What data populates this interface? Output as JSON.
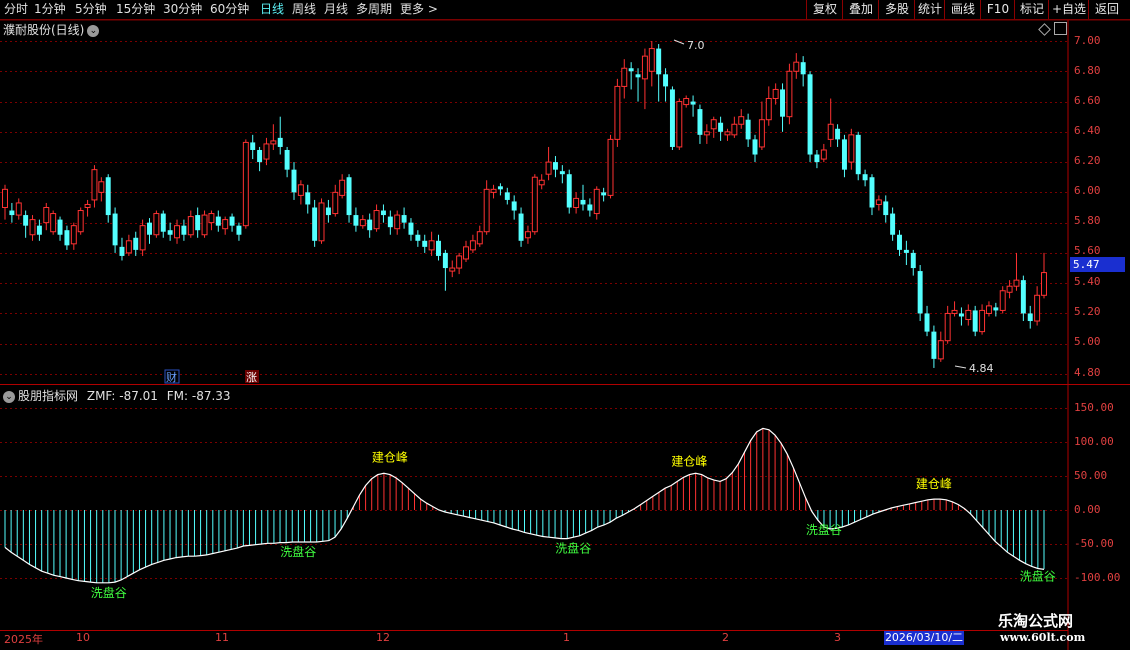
{
  "toolbar": {
    "timeframes": [
      "分时",
      "1分钟",
      "5分钟",
      "15分钟",
      "30分钟",
      "60分钟",
      "日线",
      "周线",
      "月线",
      "多周期",
      "更多 >"
    ],
    "active": "日线",
    "right_buttons": [
      "复权",
      "叠加",
      "多股",
      "统计",
      "画线",
      "F10",
      "标记",
      "+自选",
      "返回"
    ]
  },
  "stock": {
    "title": "濮耐股份(日线)"
  },
  "price_axis": {
    "labels": [
      "7.00",
      "6.80",
      "6.60",
      "6.40",
      "6.20",
      "6.00",
      "5.80",
      "5.60",
      "5.40",
      "5.20",
      "5.00",
      "4.80"
    ],
    "current": "5.47"
  },
  "markers": {
    "high": "7.0",
    "low": "4.84",
    "cai": "财",
    "zhang": "涨"
  },
  "indicator": {
    "name": "股朋指标网",
    "zmf_label": "ZMF: -87.01",
    "fm_label": "FM: -87.33",
    "axis_labels": [
      "150.00",
      "100.00",
      "50.00",
      "0.00",
      "-50.00",
      "-100.00"
    ],
    "peak_label": "建仓峰",
    "valley_label": "洗盘谷"
  },
  "date_axis": {
    "labels": [
      "2025年",
      "10",
      "11",
      "12",
      "1",
      "2",
      "3"
    ],
    "cursor_date": "2026/03/10/二"
  },
  "brand": {
    "name": "乐淘公式网",
    "url": "www.60lt.com"
  },
  "colors": {
    "up": "#ff3232",
    "down": "#54ffff",
    "grid": "#7a0000",
    "axis": "#e04040",
    "peak_text": "#ffff00",
    "valley_text": "#40ff40"
  },
  "chart_data": {
    "type": "candlestick",
    "price_ylim": [
      4.8,
      7.0
    ],
    "candles": [
      [
        5.9,
        6.02,
        5.82,
        6.05
      ],
      [
        5.88,
        5.85,
        5.8,
        5.93
      ],
      [
        5.85,
        5.93,
        5.82,
        5.96
      ],
      [
        5.85,
        5.78,
        5.7,
        5.88
      ],
      [
        5.72,
        5.82,
        5.68,
        5.85
      ],
      [
        5.78,
        5.72,
        5.68,
        5.82
      ],
      [
        5.8,
        5.9,
        5.75,
        5.93
      ],
      [
        5.74,
        5.86,
        5.72,
        5.88
      ],
      [
        5.82,
        5.72,
        5.68,
        5.84
      ],
      [
        5.75,
        5.65,
        5.62,
        5.78
      ],
      [
        5.66,
        5.78,
        5.62,
        5.8
      ],
      [
        5.74,
        5.88,
        5.72,
        5.9
      ],
      [
        5.9,
        5.92,
        5.84,
        5.95
      ],
      [
        5.95,
        6.15,
        5.9,
        6.18
      ],
      [
        6.0,
        6.07,
        5.94,
        6.1
      ],
      [
        6.1,
        5.85,
        5.8,
        6.12
      ],
      [
        5.86,
        5.65,
        5.6,
        5.9
      ],
      [
        5.64,
        5.58,
        5.55,
        5.7
      ],
      [
        5.6,
        5.68,
        5.58,
        5.72
      ],
      [
        5.7,
        5.62,
        5.58,
        5.74
      ],
      [
        5.62,
        5.78,
        5.58,
        5.82
      ],
      [
        5.8,
        5.72,
        5.66,
        5.83
      ],
      [
        5.72,
        5.86,
        5.7,
        5.88
      ],
      [
        5.86,
        5.74,
        5.7,
        5.88
      ],
      [
        5.75,
        5.72,
        5.68,
        5.8
      ],
      [
        5.7,
        5.78,
        5.66,
        5.82
      ],
      [
        5.78,
        5.72,
        5.68,
        5.82
      ],
      [
        5.72,
        5.84,
        5.7,
        5.88
      ],
      [
        5.85,
        5.75,
        5.7,
        5.9
      ],
      [
        5.72,
        5.85,
        5.7,
        5.88
      ],
      [
        5.8,
        5.86,
        5.75,
        5.88
      ],
      [
        5.84,
        5.78,
        5.74,
        5.88
      ],
      [
        5.76,
        5.82,
        5.72,
        5.84
      ],
      [
        5.84,
        5.78,
        5.74,
        5.86
      ],
      [
        5.78,
        5.72,
        5.68,
        5.8
      ],
      [
        5.78,
        6.33,
        5.76,
        6.35
      ],
      [
        6.33,
        6.28,
        6.22,
        6.38
      ],
      [
        6.28,
        6.2,
        6.14,
        6.3
      ],
      [
        6.22,
        6.32,
        6.18,
        6.36
      ],
      [
        6.32,
        6.34,
        6.28,
        6.45
      ],
      [
        6.36,
        6.3,
        6.25,
        6.5
      ],
      [
        6.28,
        6.15,
        6.1,
        6.3
      ],
      [
        6.15,
        6.0,
        5.95,
        6.2
      ],
      [
        5.98,
        6.05,
        5.92,
        6.08
      ],
      [
        6.0,
        5.92,
        5.86,
        6.05
      ],
      [
        5.9,
        5.68,
        5.64,
        5.95
      ],
      [
        5.68,
        5.93,
        5.66,
        5.96
      ],
      [
        5.9,
        5.85,
        5.8,
        5.95
      ],
      [
        5.86,
        6.0,
        5.84,
        6.05
      ],
      [
        5.98,
        6.08,
        5.96,
        6.12
      ],
      [
        6.1,
        5.85,
        5.8,
        6.12
      ],
      [
        5.85,
        5.78,
        5.74,
        5.9
      ],
      [
        5.78,
        5.82,
        5.76,
        5.85
      ],
      [
        5.82,
        5.75,
        5.7,
        5.86
      ],
      [
        5.76,
        5.88,
        5.74,
        5.92
      ],
      [
        5.88,
        5.85,
        5.8,
        5.92
      ],
      [
        5.84,
        5.77,
        5.72,
        5.88
      ],
      [
        5.76,
        5.85,
        5.72,
        5.88
      ],
      [
        5.85,
        5.8,
        5.76,
        5.9
      ],
      [
        5.8,
        5.72,
        5.68,
        5.83
      ],
      [
        5.72,
        5.68,
        5.64,
        5.75
      ],
      [
        5.68,
        5.64,
        5.6,
        5.72
      ],
      [
        5.62,
        5.68,
        5.58,
        5.74
      ],
      [
        5.68,
        5.58,
        5.55,
        5.72
      ],
      [
        5.6,
        5.5,
        5.35,
        5.62
      ],
      [
        5.48,
        5.5,
        5.44,
        5.55
      ],
      [
        5.5,
        5.58,
        5.46,
        5.6
      ],
      [
        5.56,
        5.64,
        5.54,
        5.68
      ],
      [
        5.62,
        5.68,
        5.6,
        5.72
      ],
      [
        5.66,
        5.74,
        5.64,
        5.78
      ],
      [
        5.74,
        6.02,
        5.72,
        6.08
      ],
      [
        6.0,
        6.02,
        5.96,
        6.05
      ],
      [
        6.04,
        6.02,
        5.98,
        6.06
      ],
      [
        6.0,
        5.95,
        5.92,
        6.03
      ],
      [
        5.94,
        5.88,
        5.82,
        5.98
      ],
      [
        5.86,
        5.68,
        5.64,
        5.9
      ],
      [
        5.7,
        5.74,
        5.66,
        5.78
      ],
      [
        5.74,
        6.1,
        5.72,
        6.12
      ],
      [
        6.05,
        6.08,
        6.02,
        6.12
      ],
      [
        6.12,
        6.2,
        6.08,
        6.3
      ],
      [
        6.2,
        6.15,
        6.1,
        6.24
      ],
      [
        6.14,
        6.12,
        6.06,
        6.18
      ],
      [
        6.12,
        5.9,
        5.86,
        6.15
      ],
      [
        5.9,
        5.96,
        5.86,
        6.0
      ],
      [
        5.95,
        5.92,
        5.88,
        6.05
      ],
      [
        5.92,
        5.88,
        5.84,
        5.96
      ],
      [
        5.86,
        6.02,
        5.82,
        6.04
      ],
      [
        6.0,
        5.98,
        5.94,
        6.03
      ],
      [
        5.98,
        6.35,
        5.96,
        6.38
      ],
      [
        6.35,
        6.7,
        6.3,
        6.75
      ],
      [
        6.7,
        6.82,
        6.62,
        6.88
      ],
      [
        6.82,
        6.8,
        6.68,
        6.86
      ],
      [
        6.78,
        6.76,
        6.6,
        6.82
      ],
      [
        6.75,
        6.9,
        6.55,
        6.95
      ],
      [
        6.8,
        6.95,
        6.7,
        7.0
      ],
      [
        6.95,
        6.78,
        6.6,
        6.98
      ],
      [
        6.78,
        6.7,
        6.6,
        6.82
      ],
      [
        6.68,
        6.3,
        6.28,
        6.7
      ],
      [
        6.3,
        6.6,
        6.28,
        6.62
      ],
      [
        6.58,
        6.62,
        6.56,
        6.64
      ],
      [
        6.6,
        6.58,
        6.5,
        6.64
      ],
      [
        6.55,
        6.38,
        6.32,
        6.58
      ],
      [
        6.38,
        6.4,
        6.32,
        6.45
      ],
      [
        6.42,
        6.48,
        6.36,
        6.5
      ],
      [
        6.46,
        6.4,
        6.34,
        6.5
      ],
      [
        6.38,
        6.4,
        6.34,
        6.42
      ],
      [
        6.38,
        6.45,
        6.36,
        6.5
      ],
      [
        6.45,
        6.5,
        6.42,
        6.55
      ],
      [
        6.48,
        6.35,
        6.3,
        6.52
      ],
      [
        6.35,
        6.25,
        6.2,
        6.38
      ],
      [
        6.3,
        6.48,
        6.28,
        6.6
      ],
      [
        6.48,
        6.62,
        6.44,
        6.7
      ],
      [
        6.62,
        6.68,
        6.58,
        6.72
      ],
      [
        6.68,
        6.5,
        6.4,
        6.72
      ],
      [
        6.5,
        6.8,
        6.45,
        6.85
      ],
      [
        6.8,
        6.86,
        6.75,
        6.92
      ],
      [
        6.86,
        6.78,
        6.7,
        6.9
      ],
      [
        6.78,
        6.25,
        6.2,
        6.8
      ],
      [
        6.25,
        6.2,
        6.16,
        6.28
      ],
      [
        6.22,
        6.28,
        6.2,
        6.32
      ],
      [
        6.35,
        6.45,
        6.3,
        6.62
      ],
      [
        6.42,
        6.35,
        6.3,
        6.45
      ],
      [
        6.35,
        6.15,
        6.1,
        6.38
      ],
      [
        6.2,
        6.38,
        6.15,
        6.42
      ],
      [
        6.38,
        6.12,
        6.08,
        6.4
      ],
      [
        6.12,
        6.08,
        6.04,
        6.15
      ],
      [
        6.1,
        5.9,
        5.85,
        6.12
      ],
      [
        5.92,
        5.95,
        5.88,
        5.98
      ],
      [
        5.94,
        5.85,
        5.8,
        5.98
      ],
      [
        5.86,
        5.72,
        5.68,
        5.9
      ],
      [
        5.72,
        5.62,
        5.58,
        5.75
      ],
      [
        5.62,
        5.6,
        5.52,
        5.68
      ],
      [
        5.6,
        5.5,
        5.45,
        5.62
      ],
      [
        5.48,
        5.2,
        5.15,
        5.52
      ],
      [
        5.2,
        5.08,
        5.05,
        5.25
      ],
      [
        5.08,
        4.9,
        4.84,
        5.12
      ],
      [
        4.9,
        5.02,
        4.88,
        5.08
      ],
      [
        5.02,
        5.2,
        5.0,
        5.25
      ],
      [
        5.2,
        5.22,
        5.18,
        5.28
      ],
      [
        5.2,
        5.18,
        5.12,
        5.24
      ],
      [
        5.16,
        5.22,
        5.12,
        5.26
      ],
      [
        5.22,
        5.08,
        5.05,
        5.25
      ],
      [
        5.08,
        5.22,
        5.06,
        5.26
      ],
      [
        5.2,
        5.25,
        5.18,
        5.28
      ],
      [
        5.24,
        5.22,
        5.18,
        5.27
      ],
      [
        5.22,
        5.35,
        5.2,
        5.38
      ],
      [
        5.34,
        5.38,
        5.3,
        5.42
      ],
      [
        5.38,
        5.42,
        5.35,
        5.6
      ],
      [
        5.42,
        5.2,
        5.15,
        5.45
      ],
      [
        5.2,
        5.15,
        5.1,
        5.25
      ],
      [
        5.15,
        5.32,
        5.12,
        5.38
      ],
      [
        5.32,
        5.47,
        5.3,
        5.6
      ]
    ],
    "indicator_ylim": [
      -110,
      150
    ],
    "zmf": [
      -55,
      -62,
      -68,
      -74,
      -80,
      -85,
      -90,
      -93,
      -96,
      -98,
      -100,
      -102,
      -104,
      -105,
      -106,
      -107,
      -107,
      -107,
      -106,
      -103,
      -98,
      -93,
      -88,
      -84,
      -80,
      -77,
      -74,
      -72,
      -70,
      -69,
      -68,
      -68,
      -67,
      -66,
      -64,
      -62,
      -60,
      -58,
      -56,
      -53,
      -52,
      -51,
      -50,
      -49,
      -49,
      -48,
      -48,
      -47,
      -47,
      -47,
      -47,
      -47,
      -46,
      -45,
      -40,
      -28,
      -12,
      5,
      22,
      36,
      46,
      52,
      54,
      52,
      47,
      40,
      32,
      24,
      16,
      10,
      5,
      0,
      -3,
      -5,
      -7,
      -9,
      -11,
      -13,
      -15,
      -17,
      -19,
      -22,
      -25,
      -28,
      -30,
      -33,
      -35,
      -37,
      -39,
      -40,
      -41,
      -42,
      -42,
      -40,
      -38,
      -34,
      -30,
      -25,
      -22,
      -18,
      -12,
      -8,
      -3,
      2,
      8,
      14,
      20,
      26,
      32,
      36,
      42,
      48,
      52,
      54,
      52,
      47,
      44,
      42,
      46,
      55,
      68,
      85,
      102,
      115,
      120,
      118,
      110,
      98,
      82,
      62,
      40,
      18,
      -2,
      -15,
      -25,
      -28,
      -27,
      -25,
      -22,
      -18,
      -14,
      -10,
      -6,
      -3,
      0,
      3,
      5,
      7,
      9,
      11,
      13,
      15,
      16,
      16,
      15,
      12,
      8,
      2,
      -6,
      -16,
      -26,
      -36,
      -46,
      -54,
      -62,
      -68,
      -74,
      -79,
      -83,
      -86,
      -87.01
    ],
    "fm": [
      -55,
      -62,
      -68,
      -74,
      -80,
      -85,
      -90,
      -93,
      -96,
      -98,
      -100,
      -102,
      -104,
      -105,
      -106,
      -107,
      -107,
      -107,
      -106,
      -103,
      -98,
      -93,
      -88,
      -84,
      -80,
      -77,
      -74,
      -72,
      -70,
      -69,
      -68,
      -68,
      -67,
      -66,
      -64,
      -62,
      -60,
      -58,
      -56,
      -53,
      -52,
      -51,
      -50,
      -49,
      -49,
      -48,
      -48,
      -47,
      -47,
      -47,
      -47,
      -47,
      -46,
      -45,
      -40,
      -28,
      -12,
      5,
      22,
      36,
      46,
      52,
      54,
      52,
      47,
      40,
      32,
      24,
      16,
      10,
      5,
      0,
      -3,
      -5,
      -7,
      -9,
      -11,
      -13,
      -15,
      -17,
      -19,
      -22,
      -25,
      -28,
      -30,
      -33,
      -35,
      -37,
      -39,
      -40,
      -41,
      -42,
      -42,
      -40,
      -38,
      -34,
      -30,
      -25,
      -22,
      -18,
      -12,
      -8,
      -3,
      2,
      8,
      14,
      20,
      26,
      32,
      36,
      42,
      48,
      52,
      54,
      52,
      47,
      44,
      42,
      46,
      55,
      68,
      85,
      102,
      115,
      120,
      118,
      110,
      98,
      82,
      62,
      40,
      18,
      -2,
      -15,
      -25,
      -28,
      -27,
      -25,
      -22,
      -18,
      -14,
      -10,
      -6,
      -3,
      0,
      3,
      5,
      7,
      9,
      11,
      13,
      15,
      16,
      16,
      15,
      12,
      8,
      2,
      -6,
      -16,
      -26,
      -36,
      -46,
      -54,
      -62,
      -68,
      -74,
      -79,
      -83,
      -86,
      -87.33
    ]
  }
}
